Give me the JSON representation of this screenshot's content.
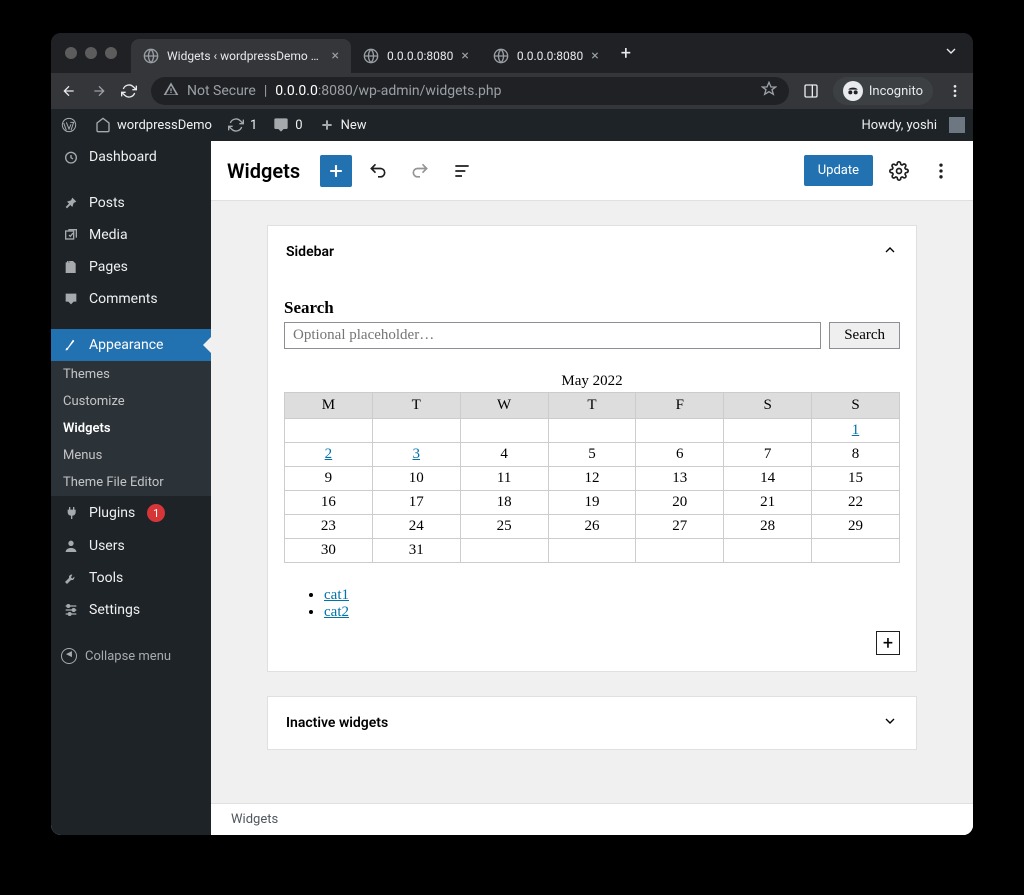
{
  "browser": {
    "tabs": [
      {
        "title": "Widgets ‹ wordpressDemo — W",
        "active": true
      },
      {
        "title": "0.0.0.0:8080",
        "active": false
      },
      {
        "title": "0.0.0.0:8080",
        "active": false
      }
    ],
    "address": {
      "security_label": "Not Secure",
      "url_host": "0.0.0.0",
      "url_path": ":8080/wp-admin/widgets.php"
    },
    "incognito_label": "Incognito"
  },
  "adminbar": {
    "site_name": "wordpressDemo",
    "update_count": "1",
    "comment_count": "0",
    "new_label": "New",
    "greeting": "Howdy, yoshi"
  },
  "sidebar": {
    "items": [
      {
        "id": "dashboard",
        "label": "Dashboard"
      },
      {
        "id": "posts",
        "label": "Posts"
      },
      {
        "id": "media",
        "label": "Media"
      },
      {
        "id": "pages",
        "label": "Pages"
      },
      {
        "id": "comments",
        "label": "Comments"
      },
      {
        "id": "appearance",
        "label": "Appearance",
        "current": true
      },
      {
        "id": "plugins",
        "label": "Plugins",
        "badge": "1"
      },
      {
        "id": "users",
        "label": "Users"
      },
      {
        "id": "tools",
        "label": "Tools"
      },
      {
        "id": "settings",
        "label": "Settings"
      }
    ],
    "appearance_submenu": [
      {
        "label": "Themes"
      },
      {
        "label": "Customize"
      },
      {
        "label": "Widgets",
        "current": true
      },
      {
        "label": "Menus"
      },
      {
        "label": "Theme File Editor"
      }
    ],
    "collapse_label": "Collapse menu"
  },
  "editor": {
    "title": "Widgets",
    "update_label": "Update",
    "areas": [
      {
        "name": "Sidebar",
        "expanded": true
      },
      {
        "name": "Inactive widgets",
        "expanded": false
      }
    ],
    "search_widget": {
      "heading": "Search",
      "placeholder": "Optional placeholder…",
      "button_label": "Search"
    },
    "calendar_widget": {
      "caption": "May 2022",
      "days": [
        "M",
        "T",
        "W",
        "T",
        "F",
        "S",
        "S"
      ],
      "weeks": [
        [
          null,
          null,
          null,
          null,
          null,
          null,
          {
            "n": "1",
            "link": true
          }
        ],
        [
          {
            "n": "2",
            "link": true
          },
          {
            "n": "3",
            "link": true
          },
          {
            "n": "4"
          },
          {
            "n": "5"
          },
          {
            "n": "6"
          },
          {
            "n": "7"
          },
          {
            "n": "8"
          }
        ],
        [
          {
            "n": "9"
          },
          {
            "n": "10"
          },
          {
            "n": "11"
          },
          {
            "n": "12"
          },
          {
            "n": "13"
          },
          {
            "n": "14"
          },
          {
            "n": "15"
          }
        ],
        [
          {
            "n": "16"
          },
          {
            "n": "17"
          },
          {
            "n": "18"
          },
          {
            "n": "19"
          },
          {
            "n": "20"
          },
          {
            "n": "21"
          },
          {
            "n": "22"
          }
        ],
        [
          {
            "n": "23"
          },
          {
            "n": "24"
          },
          {
            "n": "25"
          },
          {
            "n": "26"
          },
          {
            "n": "27"
          },
          {
            "n": "28"
          },
          {
            "n": "29"
          }
        ],
        [
          {
            "n": "30"
          },
          {
            "n": "31"
          },
          null,
          null,
          null,
          null,
          null
        ]
      ]
    },
    "categories_widget": {
      "items": [
        "cat1",
        "cat2"
      ]
    },
    "footer_breadcrumb": "Widgets"
  }
}
